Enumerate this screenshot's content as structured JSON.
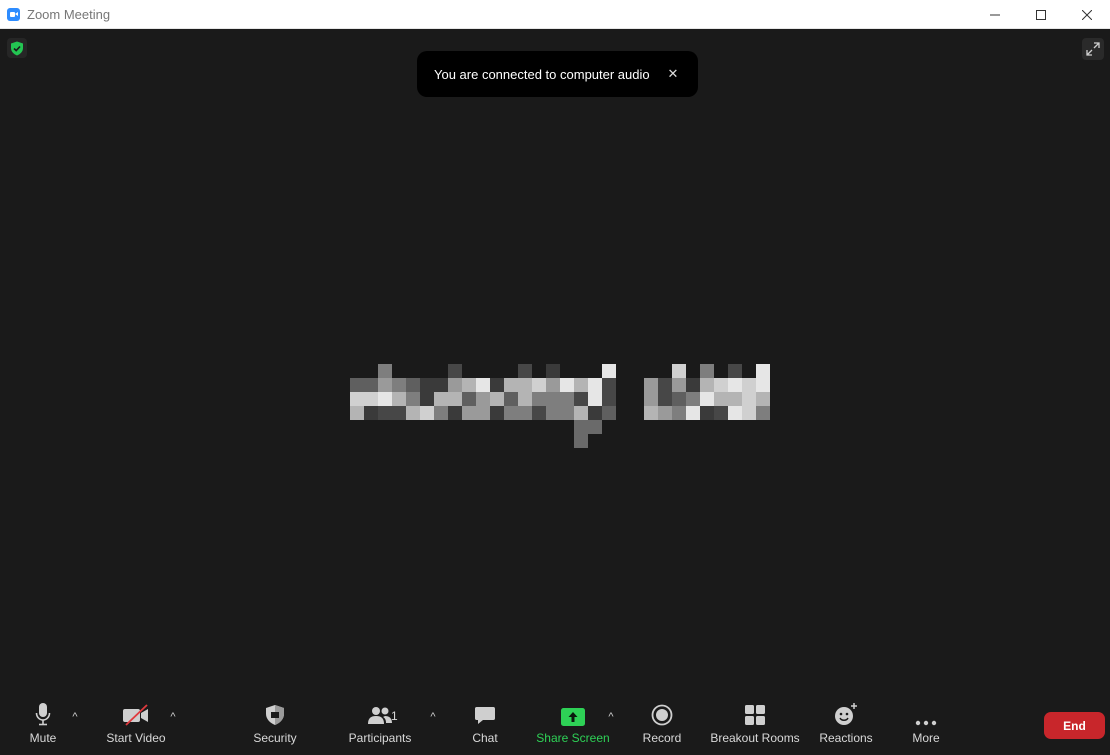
{
  "window": {
    "title": "Zoom Meeting"
  },
  "toast": {
    "message": "You are connected to computer audio",
    "close_glyph": "✕"
  },
  "toolbar": {
    "mute": {
      "label": "Mute",
      "icon": "microphone-icon"
    },
    "video": {
      "label": "Start Video",
      "icon": "video-off-icon"
    },
    "security": {
      "label": "Security",
      "icon": "shield-icon"
    },
    "participants": {
      "label": "Participants",
      "icon": "participants-icon",
      "count": "1"
    },
    "chat": {
      "label": "Chat",
      "icon": "chat-icon"
    },
    "share": {
      "label": "Share Screen",
      "icon": "share-screen-icon",
      "color": "#2ed156"
    },
    "record": {
      "label": "Record",
      "icon": "record-icon"
    },
    "breakout": {
      "label": "Breakout Rooms",
      "icon": "breakout-rooms-icon"
    },
    "reactions": {
      "label": "Reactions",
      "icon": "reactions-icon"
    },
    "more": {
      "label": "More",
      "icon": "more-icon"
    },
    "end": {
      "label": "End",
      "color": "#c8262b"
    }
  },
  "colors": {
    "background": "#1a1a1a",
    "accent_green": "#2ed156",
    "end_red": "#c8262b",
    "app_blue": "#2d8cff"
  }
}
